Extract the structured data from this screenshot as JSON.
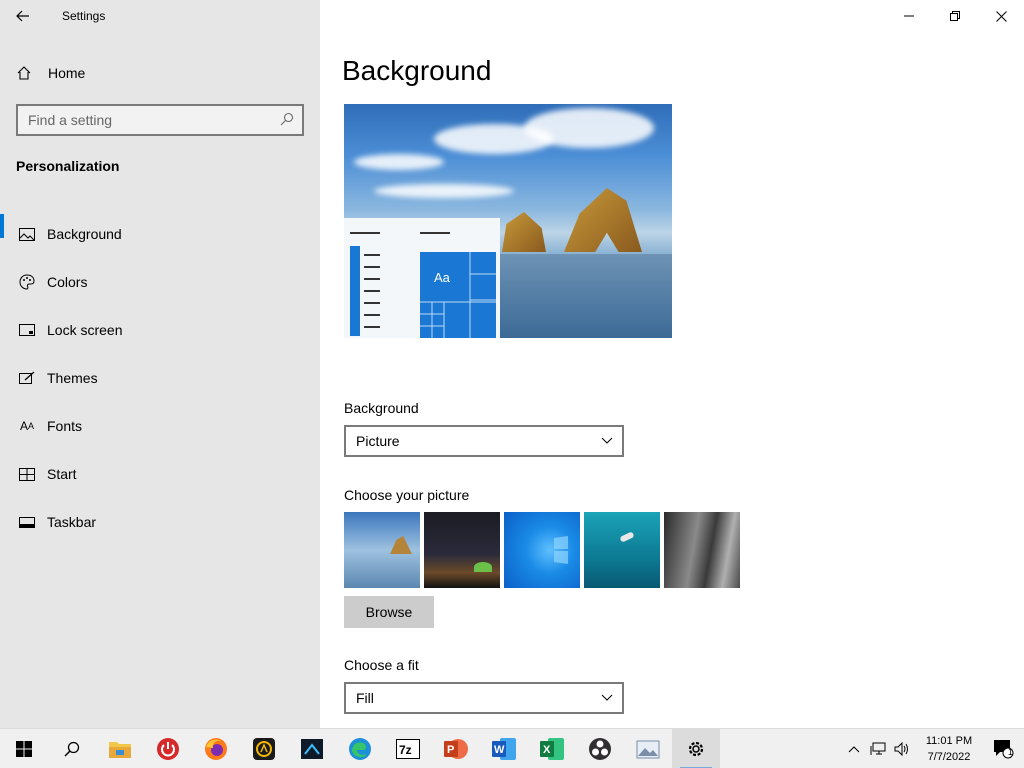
{
  "window": {
    "title": "Settings",
    "controls": [
      "minimize",
      "restore",
      "close"
    ]
  },
  "sidebar": {
    "home_label": "Home",
    "search_placeholder": "Find a setting",
    "section_title": "Personalization",
    "items": [
      {
        "label": "Background",
        "icon": "picture-icon",
        "active": true
      },
      {
        "label": "Colors",
        "icon": "palette-icon",
        "active": false
      },
      {
        "label": "Lock screen",
        "icon": "lock-screen-icon",
        "active": false
      },
      {
        "label": "Themes",
        "icon": "themes-icon",
        "active": false
      },
      {
        "label": "Fonts",
        "icon": "fonts-icon",
        "active": false
      },
      {
        "label": "Start",
        "icon": "start-icon",
        "active": false
      },
      {
        "label": "Taskbar",
        "icon": "taskbar-icon",
        "active": false
      }
    ]
  },
  "main": {
    "title": "Background",
    "preview_tile_text": "Aa",
    "background_label": "Background",
    "background_value": "Picture",
    "choose_picture_label": "Choose your picture",
    "browse_label": "Browse",
    "fit_label": "Choose a fit",
    "fit_value": "Fill"
  },
  "taskbar": {
    "apps": [
      "start-icon",
      "search-icon",
      "file-explorer-icon",
      "power-app-icon",
      "firefox-icon",
      "camera-app-icon",
      "terminal-app-icon",
      "edge-icon",
      "7zip-icon",
      "powerpoint-icon",
      "word-icon",
      "excel-icon",
      "obs-icon",
      "image-app-icon",
      "settings-icon"
    ],
    "time": "11:01 PM",
    "date": "7/7/2022",
    "notification_count": "1"
  },
  "colors": {
    "accent": "#0078d7",
    "sidebar_bg": "#e6e6e6",
    "taskbar_bg": "#f0f0f0"
  }
}
